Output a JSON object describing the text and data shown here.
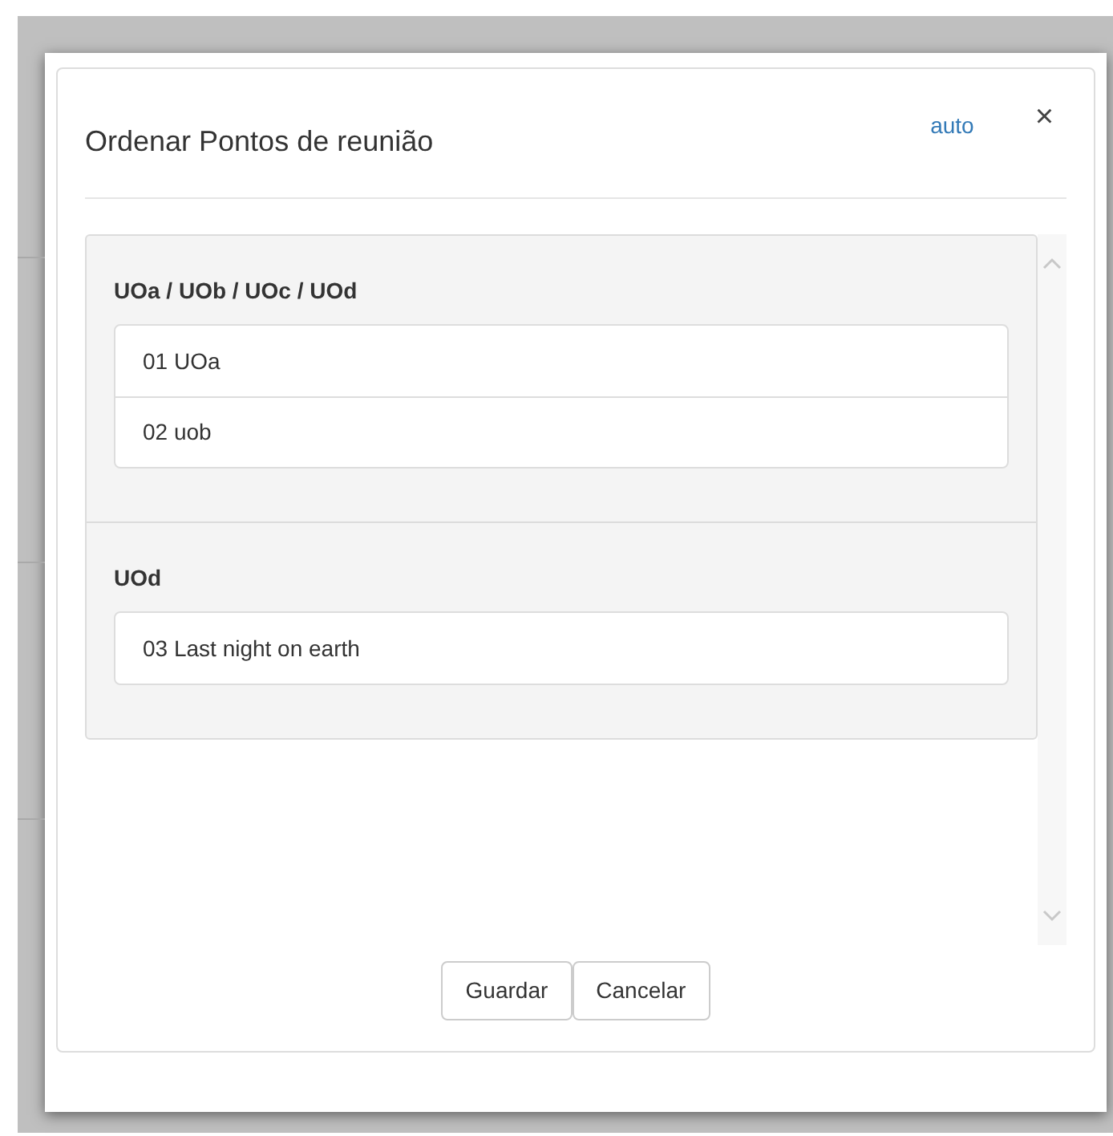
{
  "dialog": {
    "title": "Ordenar Pontos de reunião",
    "auto_link": "auto",
    "close": "×"
  },
  "groups": [
    {
      "heading": "UOa / UOb / UOc / UOd",
      "items": [
        "01 UOa",
        "02 uob"
      ]
    },
    {
      "heading": "UOd",
      "items": [
        "03 Last night on earth"
      ]
    }
  ],
  "buttons": [
    "Guardar",
    "Cancelar"
  ]
}
